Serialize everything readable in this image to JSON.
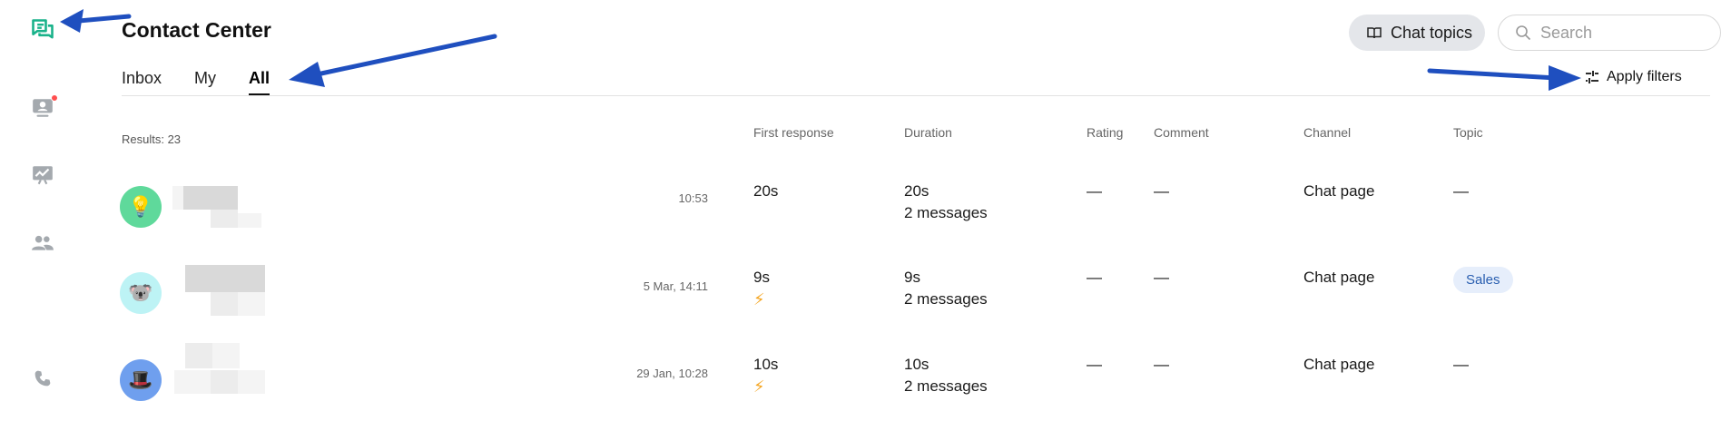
{
  "app": {
    "title": "Contact Center"
  },
  "sidebar": {
    "items": [
      {
        "icon": "chat-icon",
        "color": "#19b28a"
      },
      {
        "icon": "visitor-icon",
        "color": "#9aa0a6",
        "has_notification": true
      },
      {
        "icon": "analytics-icon",
        "color": "#9aa0a6"
      },
      {
        "icon": "team-icon",
        "color": "#9aa0a6"
      },
      {
        "icon": "phone-icon",
        "color": "#9aa0a6"
      }
    ]
  },
  "tabs": [
    {
      "label": "Inbox",
      "active": false
    },
    {
      "label": "My",
      "active": false
    },
    {
      "label": "All",
      "active": true
    }
  ],
  "toolbar": {
    "chat_topics_label": "Chat topics",
    "search_placeholder": "Search",
    "apply_filters_label": "Apply filters"
  },
  "table": {
    "results_label": "Results: 23",
    "columns": [
      "First response",
      "Duration",
      "Rating",
      "Comment",
      "Channel",
      "Topic"
    ],
    "rows": [
      {
        "avatar_emoji": "💡",
        "avatar_color": "#5fd99b",
        "time": "10:53",
        "first_response": "20s",
        "fast": false,
        "duration": "20s",
        "messages": "2 messages",
        "rating": "—",
        "comment": "—",
        "channel": "Chat page",
        "topic": "—",
        "topic_is_badge": false
      },
      {
        "avatar_emoji": "🐨",
        "avatar_color": "#bdf3f5",
        "time": "5 Mar, 14:11",
        "first_response": "9s",
        "fast": true,
        "bolt": "⚡",
        "duration": "9s",
        "messages": "2 messages",
        "rating": "—",
        "comment": "—",
        "channel": "Chat page",
        "topic": "Sales",
        "topic_is_badge": true
      },
      {
        "avatar_emoji": "🎩",
        "avatar_color": "#6f9fee",
        "time": "29 Jan, 10:28",
        "first_response": "10s",
        "fast": true,
        "bolt": "⚡",
        "duration": "10s",
        "messages": "2 messages",
        "rating": "—",
        "comment": "—",
        "channel": "Chat page",
        "topic": "—",
        "topic_is_badge": false
      }
    ]
  },
  "colors": {
    "accent": "#19b28a",
    "annotation_arrow": "#1f4fbf",
    "badge_bg": "#e6eefb",
    "badge_text": "#2a5fb0"
  }
}
